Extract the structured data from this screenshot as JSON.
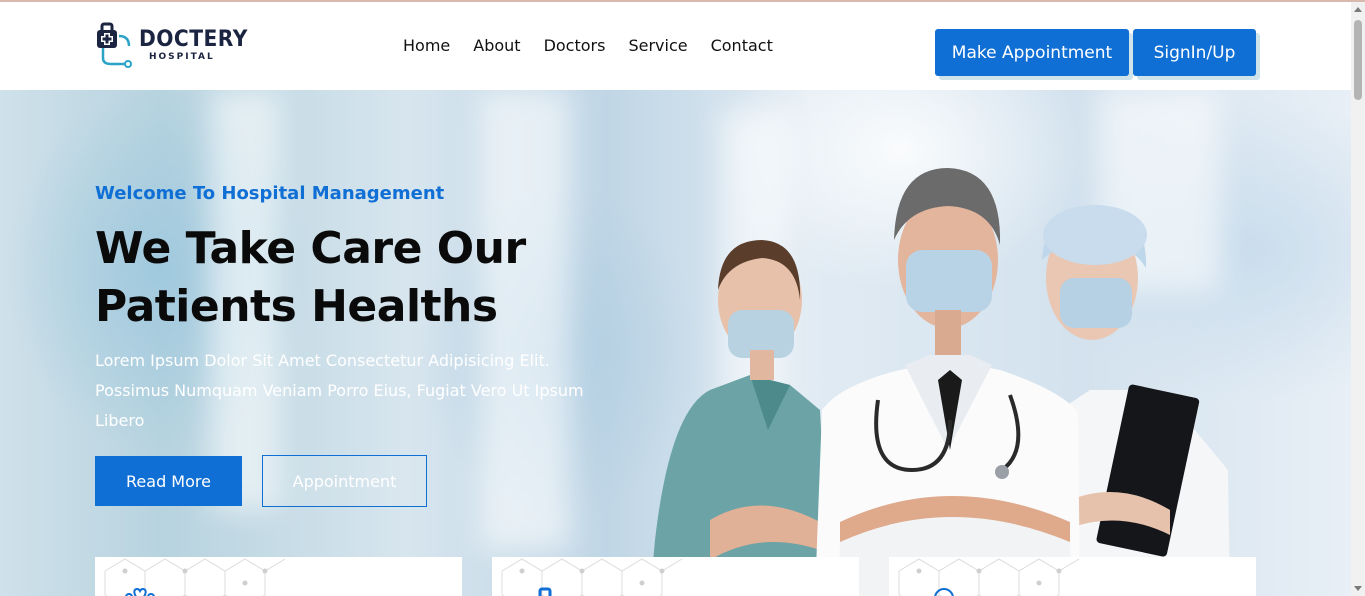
{
  "brand": {
    "name": "DOCTERY",
    "tagline": "HOSPITAL",
    "logo_icon": "medical-bag-stethoscope-icon",
    "colors": {
      "primary": "#0f6fd4",
      "dark": "#1b2440",
      "accent": "#2aa3c7"
    }
  },
  "nav": {
    "items": [
      {
        "label": "Home"
      },
      {
        "label": "About"
      },
      {
        "label": "Doctors"
      },
      {
        "label": "Service"
      },
      {
        "label": "Contact"
      }
    ]
  },
  "header_buttons": {
    "appointment_label": "Make Appointment",
    "signin_label": "SignIn/Up"
  },
  "hero": {
    "subtitle": "Welcome To Hospital Management",
    "title_line1": "We Take Care Our",
    "title_line2": "Patients Healths",
    "text": "Lorem Ipsum Dolor Sit Amet Consectetur Adipisicing Elit. Possimus Numquam Veniam Porro Eius, Fugiat Vero Ut Ipsum Libero",
    "read_more_label": "Read More",
    "appointment_label": "Appointment",
    "image_icon": "three-doctors-photo"
  },
  "feature_cards": [
    {
      "icon": "heart-hands-icon"
    },
    {
      "icon": "medical-device-icon"
    },
    {
      "icon": "search-person-icon"
    }
  ]
}
